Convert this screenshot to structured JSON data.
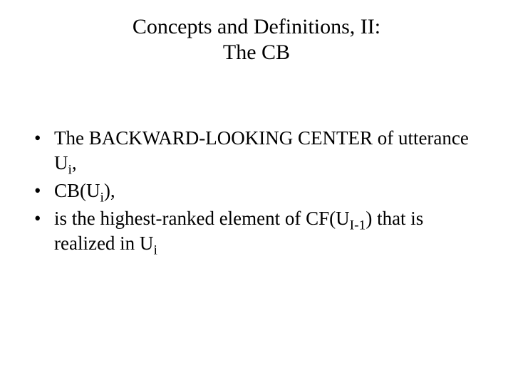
{
  "title_line1": "Concepts and Definitions, II:",
  "title_line2": "The CB",
  "bullets": {
    "b1_pre": "The BACKWARD-LOOKING CENTER of utterance U",
    "b1_sub": "i",
    "b1_post": ",",
    "b2_pre": "CB(U",
    "b2_sub": "i",
    "b2_post": "),",
    "b3_pre": "is the highest-ranked element of CF(U",
    "b3_sub": "I-1",
    "b3_mid": ") that is realized in U",
    "b3_sub2": "i"
  }
}
